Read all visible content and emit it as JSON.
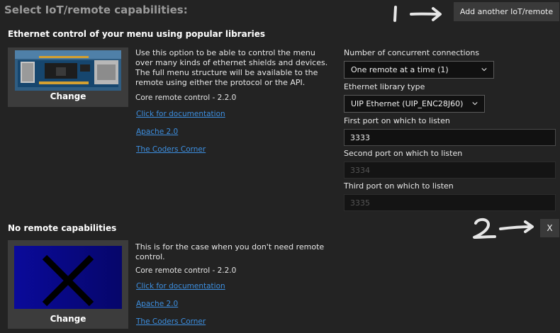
{
  "header": {
    "title": "Select IoT/remote capabilities:",
    "add_button": "Add another IoT/remote"
  },
  "annotations": {
    "one": "1",
    "two": "2"
  },
  "ethernet": {
    "title": "Ethernet control of your menu using popular libraries",
    "change_label": "Change",
    "description": "Use this option to be able to control the menu over many kinds of ethernet shields and devices. The full menu structure will be available to the remote using either the protocol or the API.",
    "version": "Core remote control - 2.2.0",
    "doc_link": "Click for documentation",
    "license_link": "Apache 2.0",
    "author_link": "The Coders Corner",
    "fields": {
      "connections_label": "Number of concurrent connections",
      "connections_value": "One remote at a time (1)",
      "library_label": "Ethernet library type",
      "library_value": "UIP Ethernet (UIP_ENC28J60)",
      "port1_label": "First port on which to listen",
      "port1_value": "3333",
      "port2_label": "Second port on which to listen",
      "port2_value": "3334",
      "port3_label": "Third port on which to listen",
      "port3_value": "3335"
    }
  },
  "none": {
    "title": "No remote capabilities",
    "change_label": "Change",
    "close_label": "X",
    "description": "This is for the case when you don't need remote control.",
    "version": "Core remote control - 2.2.0",
    "doc_link": "Click for documentation",
    "license_link": "Apache 2.0",
    "author_link": "The Coders Corner"
  },
  "colors": {
    "background": "#232323",
    "link": "#3d8fe0",
    "button": "#3a3a3a",
    "thumb_blue": "#0a0a8c"
  }
}
